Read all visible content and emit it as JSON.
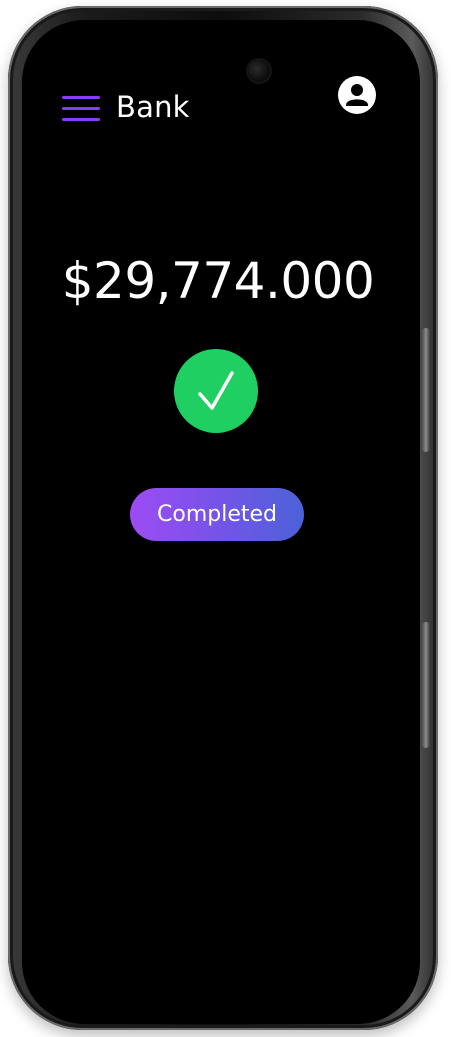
{
  "header": {
    "menu_icon": "hamburger-menu-icon",
    "title": "Bank",
    "profile_icon": "user-icon",
    "accent_color": "#8b3cf7"
  },
  "transaction": {
    "amount": "$29,774.000",
    "status_icon": "checkmark-icon",
    "status_icon_color": "#1fcf62",
    "status_label": "Completed",
    "status_gradient": [
      "#9d4cf3",
      "#4b62d8"
    ]
  }
}
